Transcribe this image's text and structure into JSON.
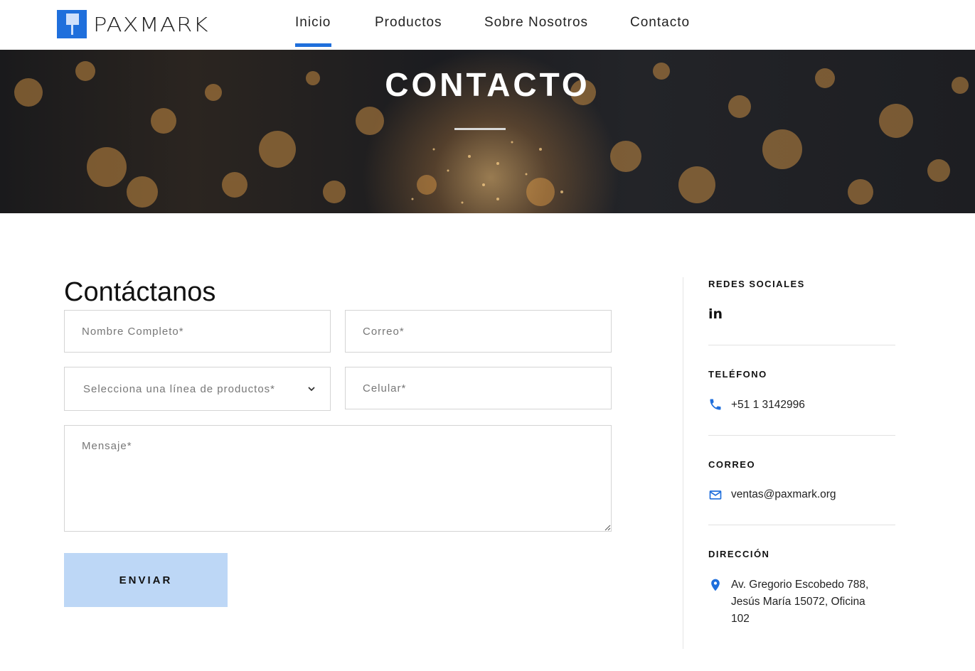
{
  "header": {
    "logo_text": "PAXMARK",
    "nav": [
      {
        "label": "Inicio",
        "active": true
      },
      {
        "label": "Productos",
        "active": false
      },
      {
        "label": "Sobre Nosotros",
        "active": false
      },
      {
        "label": "Contacto",
        "active": false
      }
    ]
  },
  "banner": {
    "title": "CONTACTO"
  },
  "form": {
    "title": "Contáctanos",
    "nombre_placeholder": "Nombre Completo*",
    "correo_placeholder": "Correo*",
    "linea_placeholder": "Selecciona una línea de productos*",
    "celular_placeholder": "Celular*",
    "mensaje_placeholder": "Mensaje*",
    "submit_label": "ENVIAR"
  },
  "sidebar": {
    "redes_heading": "REDES SOCIALES",
    "linkedin_label": "in",
    "telefono_heading": "TELÉFONO",
    "telefono_value": "+51 1 3142996",
    "correo_heading": "CORREO",
    "correo_value": "ventas@paxmark.org",
    "direccion_heading": "DIRECCIÓN",
    "direccion_lines": [
      "Av. Gregorio Escobedo 788,",
      "Jesús María 15072, Oficina",
      "102"
    ]
  },
  "colors": {
    "accent": "#1f6fdc",
    "button_bg": "#bdd7f6"
  }
}
